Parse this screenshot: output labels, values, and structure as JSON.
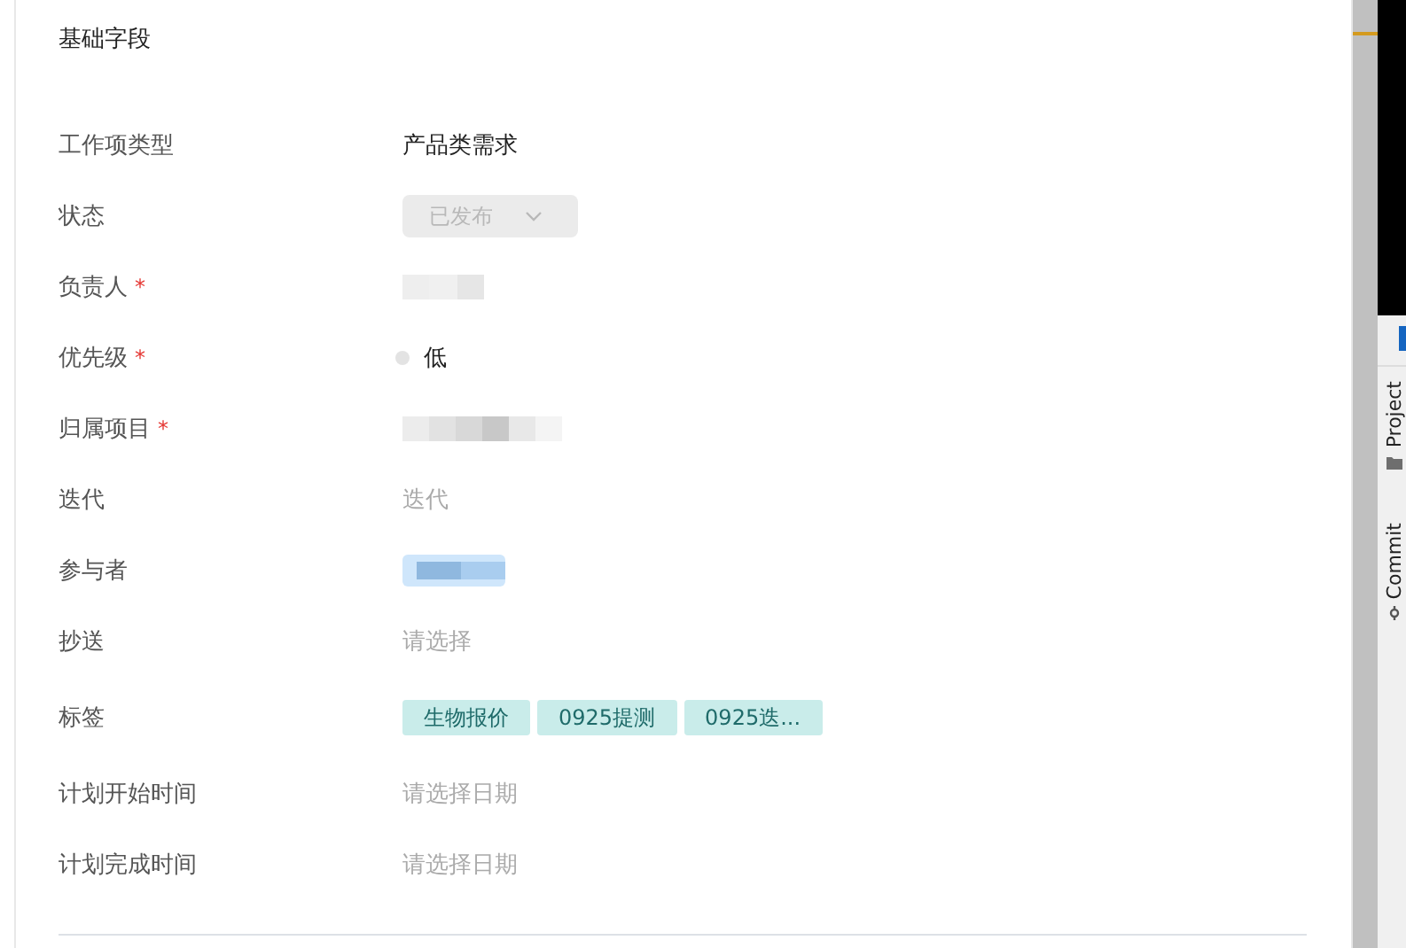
{
  "section": {
    "title": "基础字段"
  },
  "fields": [
    {
      "label": "工作项类型",
      "kind": "text",
      "value": "产品类需求"
    },
    {
      "label": "状态",
      "kind": "select",
      "value": "已发布",
      "disabled": true
    },
    {
      "label": "负责人",
      "mark": "*",
      "kind": "redacted"
    },
    {
      "label": "优先级",
      "mark": "*",
      "kind": "priority",
      "value": "低"
    },
    {
      "label": "归属项目",
      "mark": "*",
      "kind": "redacted"
    },
    {
      "label": "迭代",
      "kind": "empty",
      "placeholder": "迭代"
    },
    {
      "label": "参与者",
      "kind": "redacted-tag"
    },
    {
      "label": "抄送",
      "kind": "empty",
      "placeholder": "请选择"
    },
    {
      "label": "标签",
      "kind": "tags",
      "tags": [
        "生物报价",
        "0925提测",
        "0925迭..."
      ]
    },
    {
      "label": "计划开始时间",
      "kind": "empty",
      "placeholder": "请选择日期"
    },
    {
      "label": "计划完成时间",
      "kind": "empty",
      "placeholder": "请选择日期"
    }
  ],
  "ide_panel": {
    "tabs": [
      "Project",
      "Commit"
    ]
  }
}
